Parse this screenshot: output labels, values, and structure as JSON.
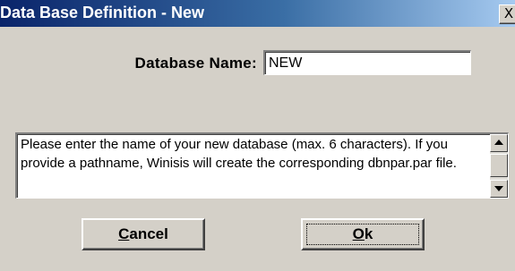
{
  "window": {
    "title": "Data Base Definition - New",
    "close_glyph": "X"
  },
  "form": {
    "name_label": "Database Name:",
    "name_value": "NEW"
  },
  "help": {
    "text": "Please enter the name of your new database (max. 6 characters). If you provide a pathname, Winisis will create the corresponding dbnpar.par file."
  },
  "buttons": {
    "cancel_mnemonic": "C",
    "cancel_rest": "ancel",
    "ok_mnemonic": "O",
    "ok_rest": "k"
  },
  "colors": {
    "titlebar_start": "#0a246a",
    "titlebar_end": "#a6caf0",
    "dialog_bg": "#d4d0c8"
  },
  "icons": {
    "close": "close-icon",
    "scroll_up": "arrow-up-icon",
    "scroll_down": "arrow-down-icon"
  }
}
